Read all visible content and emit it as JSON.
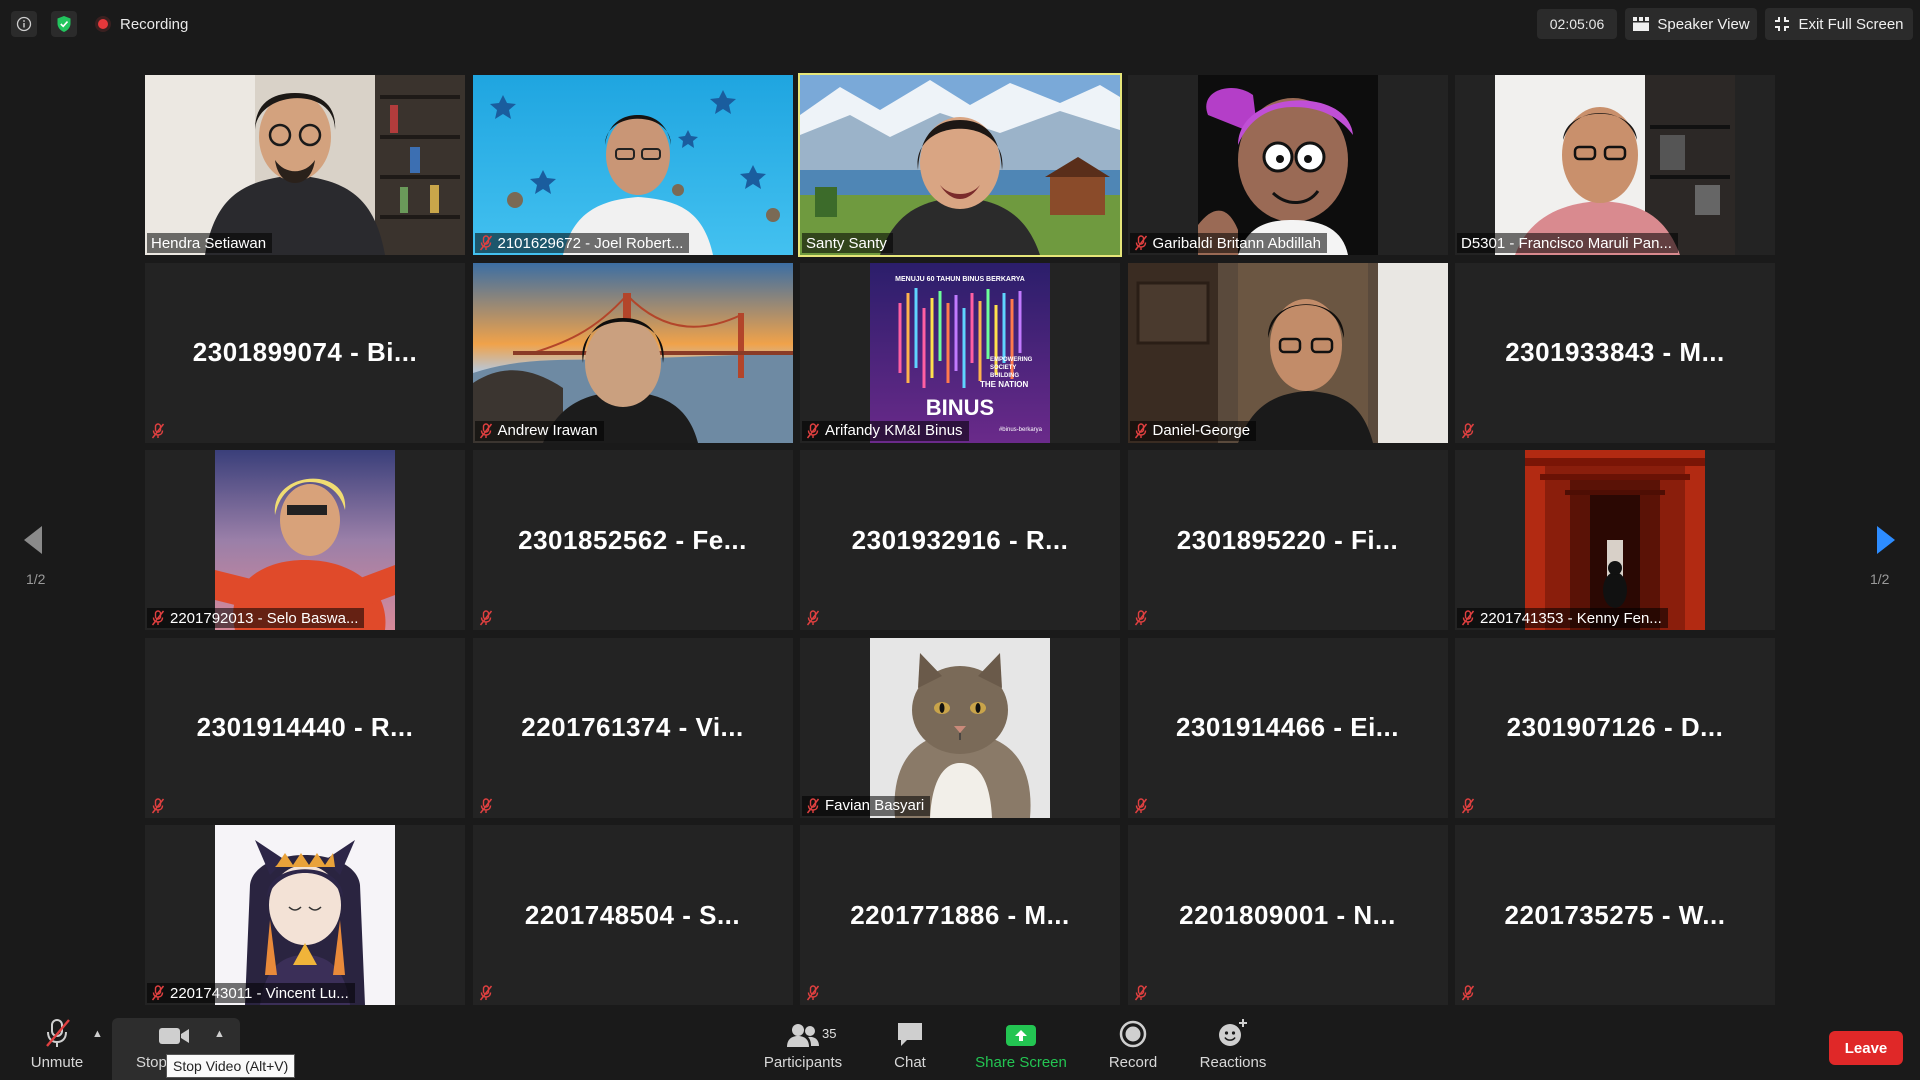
{
  "topbar": {
    "recording_label": "Recording",
    "timer": "02:05:06",
    "speaker_view_label": "Speaker View",
    "exit_fullscreen_label": "Exit Full Screen"
  },
  "pager": {
    "left_page": "1/2",
    "right_page": "1/2"
  },
  "tiles": [
    {
      "name": "Hendra Setiawan",
      "video": true,
      "muted": false
    },
    {
      "name": "2101629672 - Joel Robert...",
      "video": true,
      "muted": true
    },
    {
      "name": "Santy Santy",
      "video": true,
      "muted": false,
      "active": true
    },
    {
      "name": "Garibaldi Britann Abdillah",
      "video": true,
      "muted": true
    },
    {
      "name": "D5301 - Francisco Maruli Pan...",
      "video": true,
      "muted": false
    },
    {
      "display_name": "2301899074 - Bi...",
      "video": false,
      "muted": true
    },
    {
      "name": "Andrew Irawan",
      "video": true,
      "muted": true
    },
    {
      "name": "Arifandy KM&I Binus",
      "video": true,
      "muted": true,
      "poster": {
        "top": "MENUJU 60 TAHUN BINUS BERKARYA",
        "line1": "EMPOWERING",
        "line2": "SOCIETY",
        "line3": "BUILDING",
        "line4": "THE NATION",
        "brand": "BINUS",
        "tag": "#binus-berkarya"
      }
    },
    {
      "name": "Daniel-George",
      "video": true,
      "muted": true
    },
    {
      "display_name": "2301933843 - M...",
      "video": false,
      "muted": true
    },
    {
      "name": "2201792013 - Selo Baswa...",
      "video": true,
      "muted": true
    },
    {
      "display_name": "2301852562 - Fe...",
      "video": false,
      "muted": true
    },
    {
      "display_name": "2301932916 - R...",
      "video": false,
      "muted": true
    },
    {
      "display_name": "2301895220 - Fi...",
      "video": false,
      "muted": true
    },
    {
      "name": "2201741353 - Kenny Fen...",
      "video": true,
      "muted": true
    },
    {
      "display_name": "2301914440 - R...",
      "video": false,
      "muted": true
    },
    {
      "display_name": "2201761374 - Vi...",
      "video": false,
      "muted": true
    },
    {
      "name": "Favian Basyari",
      "video": true,
      "muted": true
    },
    {
      "display_name": "2301914466 - Ei...",
      "video": false,
      "muted": true
    },
    {
      "display_name": "2301907126 - D...",
      "video": false,
      "muted": true
    },
    {
      "name": "2201743011 - Vincent Lu...",
      "video": true,
      "muted": true
    },
    {
      "display_name": "2201748504 - S...",
      "video": false,
      "muted": true
    },
    {
      "display_name": "2201771886 - M...",
      "video": false,
      "muted": true
    },
    {
      "display_name": "2201809001 - N...",
      "video": false,
      "muted": true
    },
    {
      "display_name": "2201735275 - W...",
      "video": false,
      "muted": true
    }
  ],
  "toolbar": {
    "unmute_label": "Unmute",
    "stop_video_label": "Stop Video",
    "stop_video_tooltip": "Stop Video (Alt+V)",
    "participants_label": "Participants",
    "participants_count": "35",
    "chat_label": "Chat",
    "share_screen_label": "Share Screen",
    "record_label": "Record",
    "reactions_label": "Reactions",
    "leave_label": "Leave"
  },
  "colors": {
    "background": "#1a1a1a",
    "tile_bg": "#232323",
    "active_speaker_border": "#e6e67a",
    "recording_red": "#e5383b",
    "share_green": "#23c552",
    "leave_red": "#e02828",
    "pager_arrow_active": "#2d8cff",
    "muted_red": "#e04040"
  }
}
